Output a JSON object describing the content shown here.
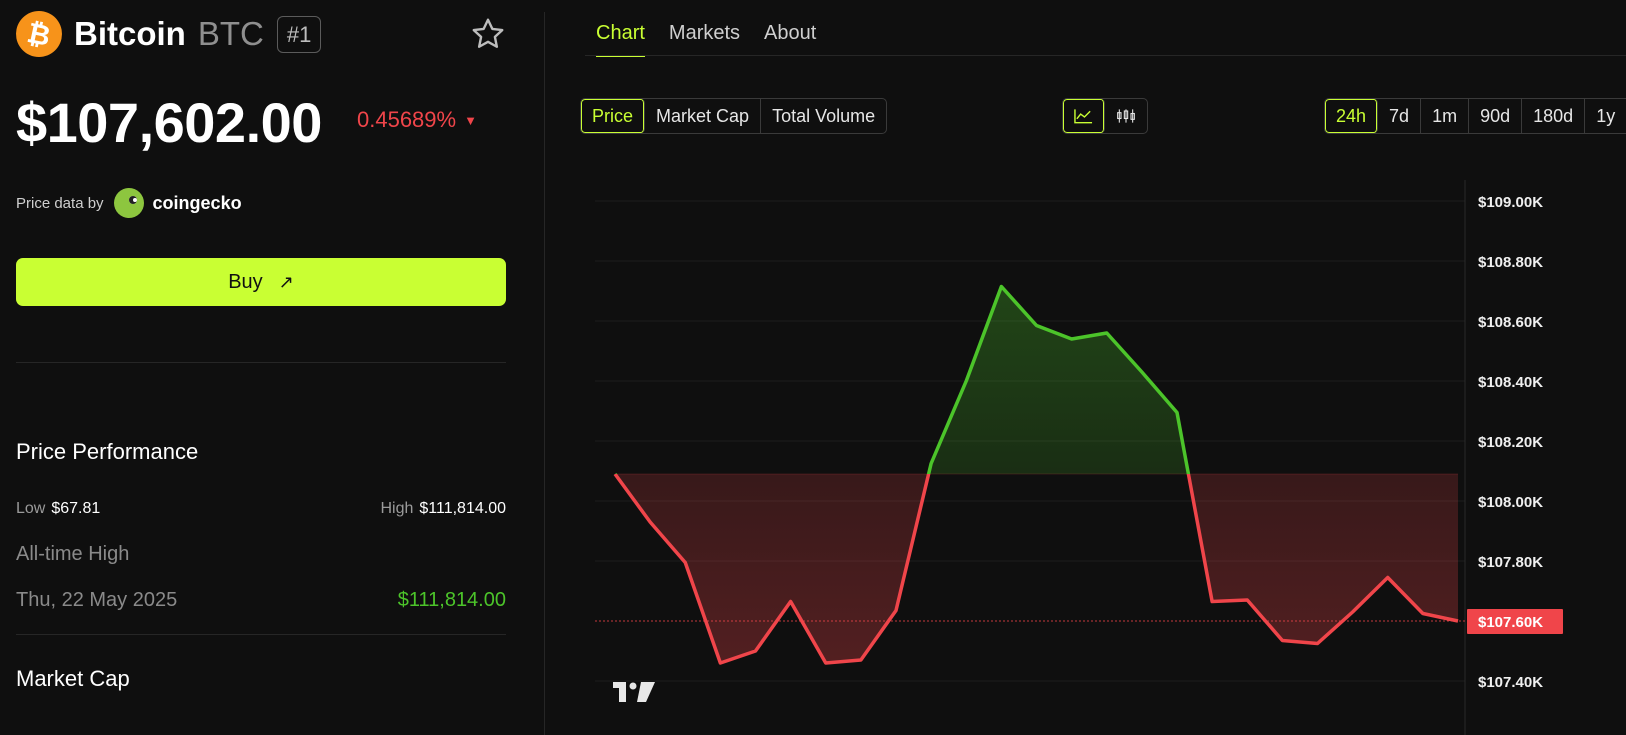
{
  "coin": {
    "name": "Bitcoin",
    "symbol": "BTC",
    "rank": "#1",
    "logo_glyph": "₿",
    "price": "$107,602.00",
    "change": "0.45689%",
    "change_direction_glyph": "▼",
    "price_data_label": "Price data by",
    "provider": "coingecko",
    "buy_label": "Buy",
    "buy_arrow": "↗"
  },
  "performance": {
    "title": "Price Performance",
    "low_label": "Low",
    "low_value": "$67.81",
    "high_label": "High",
    "high_value": "$111,814.00",
    "ath_label": "All-time High",
    "ath_date": "Thu, 22 May 2025",
    "ath_value": "$111,814.00"
  },
  "market_cap_title": "Market Cap",
  "tabs": [
    {
      "label": "Chart",
      "active": true
    },
    {
      "label": "Markets",
      "active": false
    },
    {
      "label": "About",
      "active": false
    }
  ],
  "metric_options": [
    "Price",
    "Market Cap",
    "Total Volume"
  ],
  "metric_selected": "Price",
  "chart_style_selected": "line",
  "range_options": [
    "24h",
    "7d",
    "1m",
    "90d",
    "180d",
    "1y"
  ],
  "range_selected": "24h",
  "colors": {
    "accent": "#c9ff33",
    "up": "#4cc42a",
    "down": "#f0454a",
    "background": "#0f0f0f"
  },
  "chart_data": {
    "type": "line",
    "ylim": [
      107350,
      109050
    ],
    "y_ticks": [
      "$109.00K",
      "$108.80K",
      "$108.60K",
      "$108.40K",
      "$108.20K",
      "$108.00K",
      "$107.80K",
      "$107.40K"
    ],
    "y_tick_values": [
      109000,
      108800,
      108600,
      108400,
      108200,
      108000,
      107800,
      107400
    ],
    "baseline": 108090,
    "current_label": "$107.60K",
    "current_value": 107600,
    "values": [
      108090,
      107930,
      107795,
      107460,
      107500,
      107665,
      107460,
      107470,
      107635,
      108125,
      108400,
      108715,
      108585,
      108540,
      108560,
      108430,
      108295,
      107665,
      107670,
      107535,
      107525,
      107630,
      107745,
      107625,
      107600
    ]
  }
}
